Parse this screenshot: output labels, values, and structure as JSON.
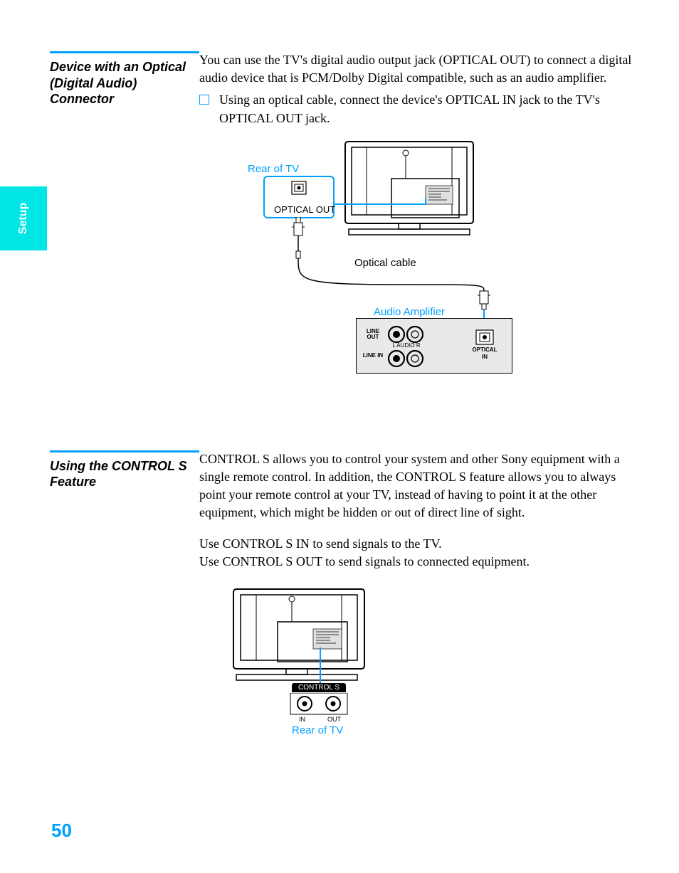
{
  "side_tab": "Setup",
  "page_number": "50",
  "section1": {
    "title": "Device with an Optical (Digital Audio) Connector",
    "intro": "You can use the TV's digital audio output jack (OPTICAL OUT) to connect a digital audio device that is PCM/Dolby Digital compatible, such as an audio amplifier.",
    "bullet": "Using an optical cable, connect the device's OPTICAL IN jack to the TV's OPTICAL OUT jack.",
    "fig": {
      "rear_of_tv": "Rear of TV",
      "optical_out": "OPTICAL OUT",
      "optical_cable": "Optical cable",
      "audio_amplifier": "Audio Amplifier",
      "line_out": "LINE OUT",
      "line_in": "LINE IN",
      "l_audio_r": "L AUDIO R",
      "optical_in_1": "OPTICAL",
      "optical_in_2": "IN"
    }
  },
  "section2": {
    "title": "Using the CONTROL S Feature",
    "para1": "CONTROL S allows you to control your system and other Sony equipment with a single remote control. In addition, the CONTROL S feature allows you to always point your remote control at your TV, instead of having to point it at the other equipment, which might be hidden or out of direct line of sight.",
    "para2": "Use CONTROL S IN to send signals to the TV.",
    "para3": "Use CONTROL S OUT to send signals to connected equipment.",
    "fig": {
      "control_s": "CONTROL S",
      "in": "IN",
      "out": "OUT",
      "rear_of_tv": "Rear of TV"
    }
  }
}
